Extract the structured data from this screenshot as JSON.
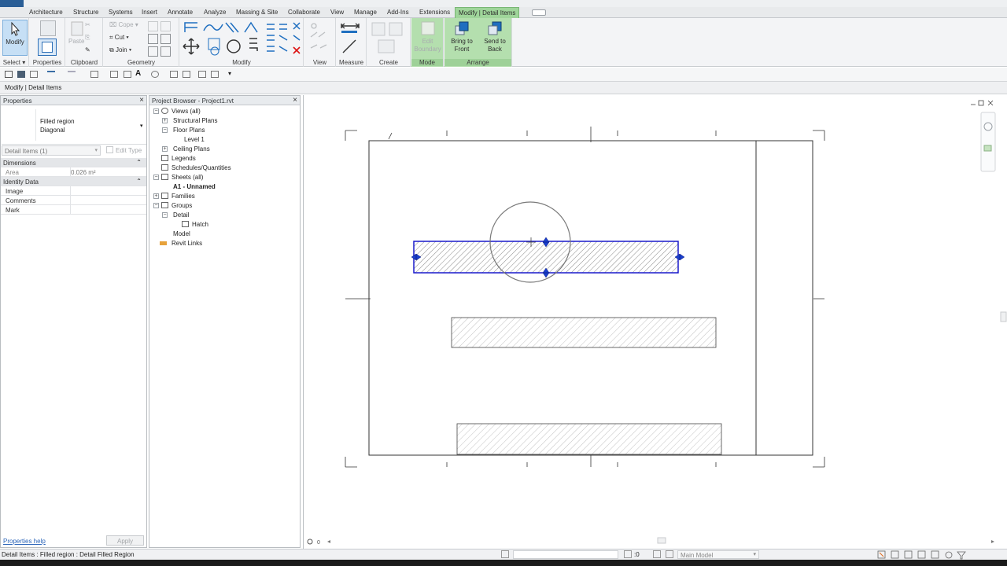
{
  "tabs": [
    "Architecture",
    "Structure",
    "Systems",
    "Insert",
    "Annotate",
    "Analyze",
    "Massing & Site",
    "Collaborate",
    "View",
    "Manage",
    "Add-Ins",
    "Extensions",
    "Modify | Detail Items"
  ],
  "ribbon": {
    "select": {
      "modify_label": "Modify",
      "panel_label": "Select",
      "dropdown": "▾"
    },
    "properties": {
      "panel_label": "Properties"
    },
    "clipboard": {
      "paste_label": "Paste",
      "cope_label": "Cope",
      "cut_label": "Cut",
      "join_label": "Join",
      "panel_label": "Clipboard"
    },
    "geometry": {
      "panel_label": "Geometry"
    },
    "modify": {
      "panel_label": "Modify"
    },
    "view": {
      "panel_label": "View"
    },
    "measure": {
      "panel_label": "Measure"
    },
    "create": {
      "panel_label": "Create"
    },
    "mode": {
      "edit_boundary_line1": "Edit",
      "edit_boundary_line2": "Boundary",
      "panel_label": "Mode"
    },
    "arrange": {
      "bring_front_line1": "Bring to",
      "bring_front_line2": "Front",
      "send_back_line1": "Send to",
      "send_back_line2": "Back",
      "panel_label": "Arrange"
    }
  },
  "context_bar": {
    "label": "Modify | Detail Items"
  },
  "properties_panel": {
    "title": "Properties",
    "type_name_line1": "Filled region",
    "type_name_line2": "Diagonal",
    "instance_selector": "Detail Items (1)",
    "edit_type": "Edit Type",
    "groups": [
      {
        "name": "Dimensions",
        "rows": [
          {
            "key": "Area",
            "value": "0.026 m²"
          }
        ]
      },
      {
        "name": "Identity Data",
        "rows": [
          {
            "key": "Image",
            "value": ""
          },
          {
            "key": "Comments",
            "value": ""
          },
          {
            "key": "Mark",
            "value": ""
          }
        ]
      }
    ],
    "help_link": "Properties help",
    "apply_button": "Apply"
  },
  "project_browser": {
    "title": "Project Browser - Project1.rvt",
    "items": {
      "views_all": "Views (all)",
      "structural_plans": "Structural Plans",
      "floor_plans": "Floor Plans",
      "level1": "Level 1",
      "ceiling_plans": "Ceiling Plans",
      "legends": "Legends",
      "schedules": "Schedules/Quantities",
      "sheets_all": "Sheets (all)",
      "sheet_a1": "A1 - Unnamed",
      "families": "Families",
      "groups": "Groups",
      "detail": "Detail",
      "hatch": "Hatch",
      "model": "Model",
      "revit_links": "Revit Links"
    }
  },
  "status_bar": {
    "selection_text": "Detail Items : Filled region : Detail Filled Region",
    "selection_count": ":0",
    "model_selector": "Main Model",
    "view_scale": "0"
  },
  "colors": {
    "selected_region_stroke": "#1a1acc",
    "hatch": "#9a9a9a",
    "context_tab": "#9fd59a"
  }
}
